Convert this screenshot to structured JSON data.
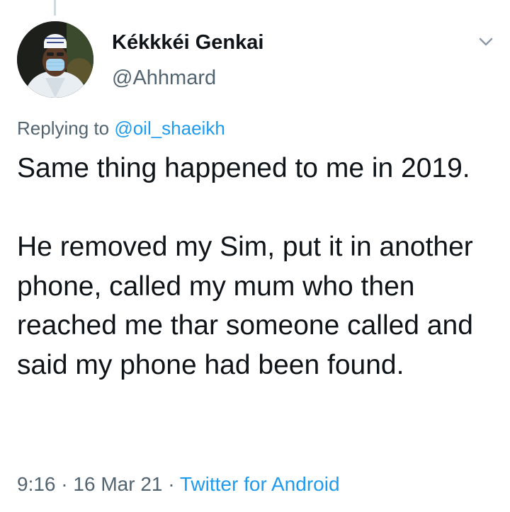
{
  "tweet": {
    "author": {
      "display_name": "Kékkkéi Genkai",
      "handle": "@Ahhmard"
    },
    "replying_label": "Replying to",
    "replying_to": "@oil_shaeikh",
    "paragraphs": [
      "Same thing happened to me in 2019.",
      "He removed my Sim, put it in another phone, called my mum who then reached me thar someone called and said my phone had been found."
    ],
    "time": "9:16",
    "separator": "·",
    "date": "16 Mar 21",
    "source": "Twitter for Android"
  },
  "icons": {
    "more_menu": "chevron-down-icon",
    "avatar": "profile-photo"
  },
  "colors": {
    "link": "#1d9bf0",
    "secondary_text": "#536471",
    "primary_text": "#0f1419",
    "background": "#ffffff",
    "thread_line": "#cfd9de"
  }
}
